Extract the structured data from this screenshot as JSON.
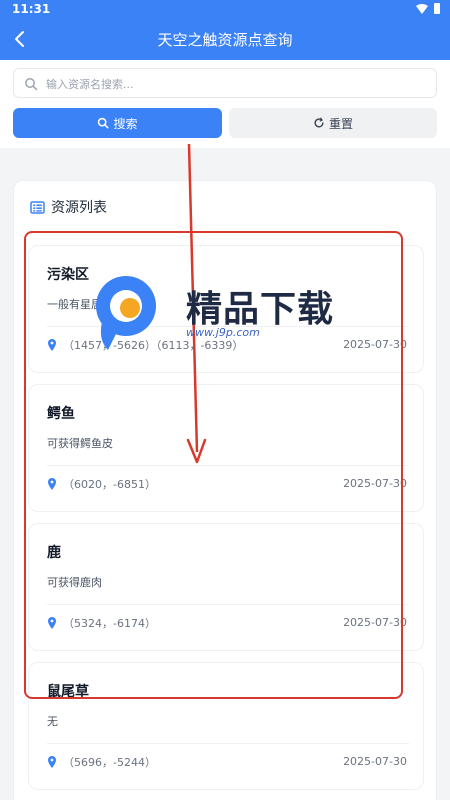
{
  "status_bar": {
    "time": "11:31"
  },
  "app_bar": {
    "title": "天空之触资源点查询"
  },
  "search": {
    "placeholder": "输入资源名搜索...",
    "search_label": "搜索",
    "reset_label": "重置"
  },
  "list": {
    "heading": "资源列表",
    "items": [
      {
        "name": "污染区",
        "desc": "一般有星居、石",
        "coords": "（1457，-5626）（6113，-6339）",
        "date": "2025-07-30"
      },
      {
        "name": "鳄鱼",
        "desc": "可获得鳄鱼皮",
        "coords": "（6020，-6851）",
        "date": "2025-07-30"
      },
      {
        "name": "鹿",
        "desc": "可获得鹿肉",
        "coords": "（5324，-6174）",
        "date": "2025-07-30"
      },
      {
        "name": "鼠尾草",
        "desc": "无",
        "coords": "（5696，-5244）",
        "date": "2025-07-30"
      }
    ]
  },
  "watermark": {
    "text": "精品下载",
    "url": "www.j9p.com"
  },
  "colors": {
    "primary": "#3b82f6",
    "annotation": "#d73a2c",
    "pin": "#3b82f6"
  }
}
